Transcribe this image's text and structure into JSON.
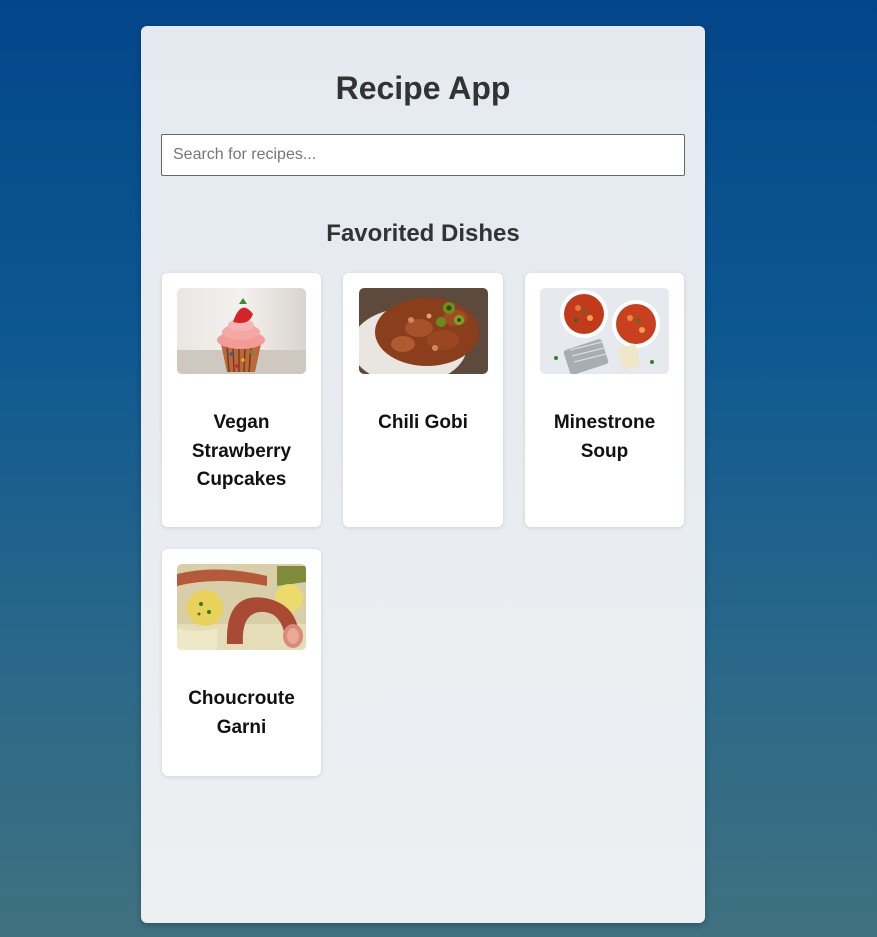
{
  "app": {
    "title": "Recipe App"
  },
  "search": {
    "placeholder": "Search for recipes...",
    "value": ""
  },
  "favorites": {
    "heading": "Favorited Dishes",
    "items": [
      {
        "name": "Vegan Strawberry Cupcakes",
        "image_icon": "cupcake-image"
      },
      {
        "name": "Chili Gobi",
        "image_icon": "chili-gobi-image"
      },
      {
        "name": "Minestrone Soup",
        "image_icon": "minestrone-soup-image"
      },
      {
        "name": "Choucroute Garni",
        "image_icon": "choucroute-garni-image"
      }
    ]
  },
  "colors": {
    "background_top": "#03468a",
    "background_bottom": "#3f7180",
    "panel": "#e5eaf1",
    "card": "#ffffff",
    "text": "#333333"
  }
}
